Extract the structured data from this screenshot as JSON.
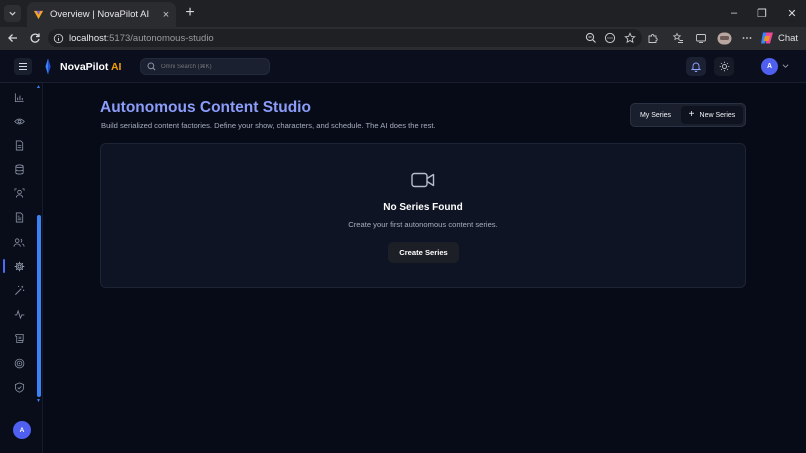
{
  "browser": {
    "tab_title": "Overview | NovaPilot AI",
    "tab_close": "×",
    "new_tab": "+",
    "url_host": "localhost",
    "url_path": ":5173/autonomous-studio",
    "chat_label": "Chat",
    "win_minimize": "–",
    "win_restore": "❐",
    "win_close": "✕"
  },
  "app": {
    "brand_name": "NovaPilot",
    "brand_ai": " AI",
    "search_placeholder": "Omni Search (⌘K)",
    "avatar_initial": "A",
    "accent_color": "#4f5ff0"
  },
  "sidebar": {
    "items": [
      {
        "icon": "bar-chart-icon"
      },
      {
        "icon": "eye-icon"
      },
      {
        "icon": "document-icon"
      },
      {
        "icon": "database-icon"
      },
      {
        "icon": "scan-user-icon"
      },
      {
        "icon": "file-text-icon"
      },
      {
        "icon": "users-icon"
      },
      {
        "icon": "gear-icon",
        "active": true
      },
      {
        "icon": "magic-wand-icon"
      },
      {
        "icon": "activity-icon"
      },
      {
        "icon": "scroll-icon"
      },
      {
        "icon": "target-icon"
      },
      {
        "icon": "shield-icon"
      }
    ],
    "avatar_initial": "A"
  },
  "main": {
    "title": "Autonomous Content Studio",
    "subtitle": "Build serialized content factories. Define your show, characters, and schedule. The AI does the rest.",
    "my_series_label": "My Series",
    "new_series_label": "New Series",
    "new_series_plus": "+",
    "empty_title": "No Series Found",
    "empty_desc": "Create your first autonomous content series.",
    "create_series_label": "Create Series"
  }
}
